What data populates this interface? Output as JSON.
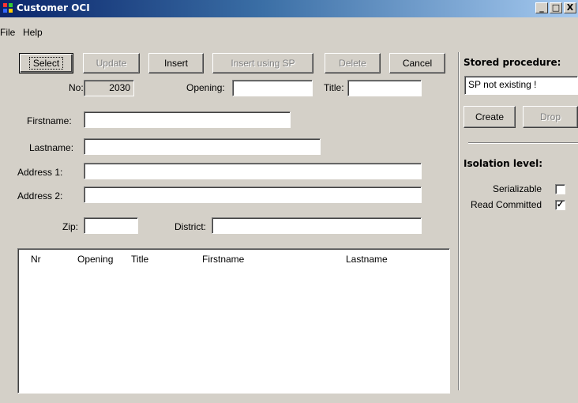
{
  "window": {
    "title": "Customer OCI",
    "minimize": "_",
    "maximize": "□",
    "close": "X",
    "icon": "app-grid-icon",
    "title_gradient": [
      "#0a246a",
      "#a6caf0"
    ]
  },
  "menu": {
    "items": [
      "File",
      "Help"
    ]
  },
  "toolbar": {
    "select": "Select",
    "update": "Update",
    "insert": "Insert",
    "insert_sp": "Insert using SP",
    "delete": "Delete",
    "cancel": "Cancel"
  },
  "form": {
    "no_label": "No:",
    "no_value": "2030",
    "opening_label": "Opening:",
    "opening_value": "",
    "title_label": "Title:",
    "title_value": "",
    "firstname_label": "Firstname:",
    "firstname_value": "",
    "lastname_label": "Lastname:",
    "lastname_value": "",
    "address1_label": "Address 1:",
    "address1_value": "",
    "address2_label": "Address 2:",
    "address2_value": "",
    "zip_label": "Zip:",
    "zip_value": "",
    "district_label": "District:",
    "district_value": ""
  },
  "list": {
    "columns": [
      "Nr",
      "Opening",
      "Title",
      "Firstname",
      "Lastname"
    ],
    "rows": []
  },
  "stored_procedure": {
    "heading": "Stored procedure:",
    "status_value": "SP not existing !",
    "create": "Create",
    "drop": "Drop"
  },
  "isolation": {
    "heading": "Isolation level:",
    "serializable_label": "Serializable",
    "serializable_checked": false,
    "read_committed_label": "Read Committed",
    "read_committed_checked": true,
    "check_mark": "✓"
  }
}
